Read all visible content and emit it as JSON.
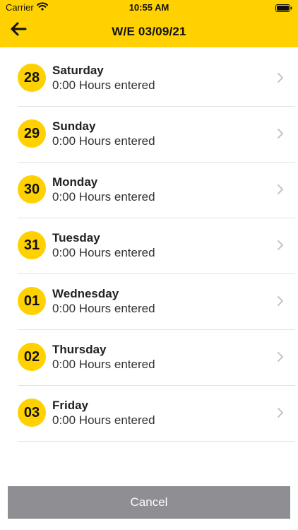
{
  "status_bar": {
    "carrier": "Carrier",
    "time": "10:55 AM",
    "icons": [
      "wifi-icon",
      "battery-icon"
    ]
  },
  "header": {
    "title": "W/E 03/09/21",
    "back_icon": "arrow-left-icon"
  },
  "days": [
    {
      "number": "28",
      "name": "Saturday",
      "hours": "0:00 Hours entered"
    },
    {
      "number": "29",
      "name": "Sunday",
      "hours": "0:00 Hours entered"
    },
    {
      "number": "30",
      "name": "Monday",
      "hours": "0:00 Hours entered"
    },
    {
      "number": "31",
      "name": "Tuesday",
      "hours": "0:00 Hours entered"
    },
    {
      "number": "01",
      "name": "Wednesday",
      "hours": "0:00 Hours entered"
    },
    {
      "number": "02",
      "name": "Thursday",
      "hours": "0:00 Hours entered"
    },
    {
      "number": "03",
      "name": "Friday",
      "hours": "0:00 Hours entered"
    }
  ],
  "footer": {
    "cancel_label": "Cancel"
  },
  "colors": {
    "accent": "#FFD100",
    "cancel_bg": "#8E8E93",
    "separator": "#E2E2E2"
  }
}
